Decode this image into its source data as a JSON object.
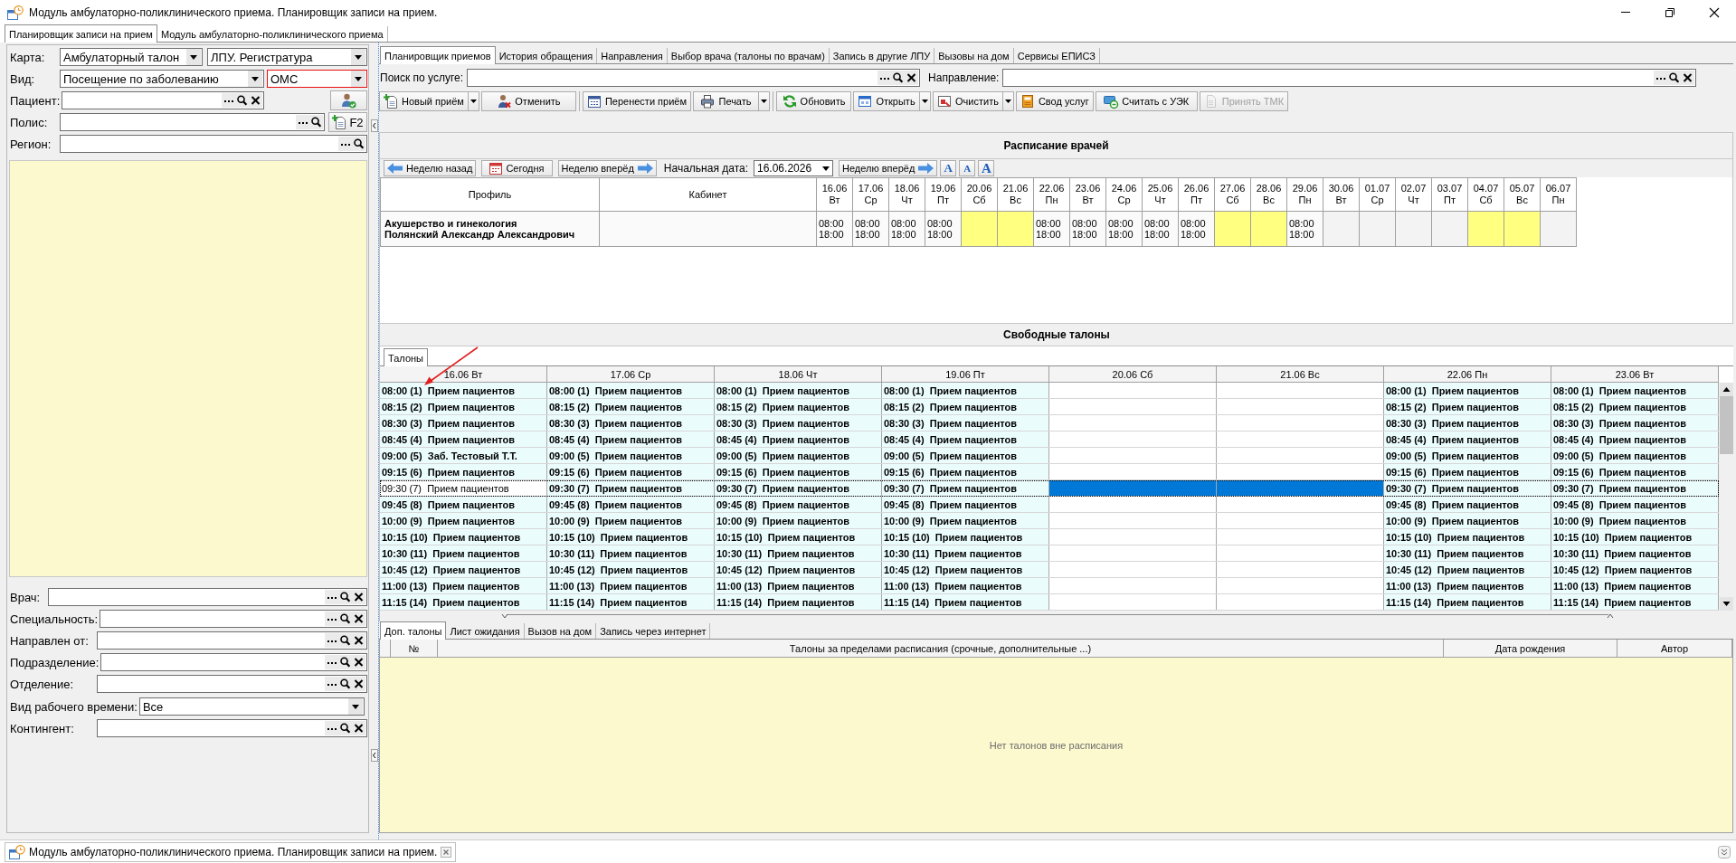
{
  "window": {
    "title": "Модуль амбулаторно-поликлинического приема. Планировщик записи на прием."
  },
  "module_tabs": [
    {
      "label": "Планировщик записи на прием",
      "selected": true
    },
    {
      "label": "Модуль амбулаторно-поликлинического приема",
      "selected": false
    }
  ],
  "patient_filters": [
    {
      "label": "Карта:",
      "controls": [
        {
          "kind": "combo",
          "value": "Амбулаторный талон",
          "invalid": false
        },
        {
          "kind": "combo",
          "value": "ЛПУ. Регистратура",
          "invalid": false
        }
      ]
    },
    {
      "label": "Вид:",
      "controls": [
        {
          "kind": "combo",
          "value": "Посещение по заболеванию",
          "invalid": false
        },
        {
          "kind": "combo",
          "value": "ОМС",
          "invalid": true
        }
      ]
    },
    {
      "label": "Пациент:",
      "controls": [
        {
          "kind": "lookup",
          "clearable": true
        },
        {
          "kind": "user-button"
        }
      ]
    },
    {
      "label": "Полис:",
      "controls": [
        {
          "kind": "lookup",
          "clearable": false
        },
        {
          "kind": "add-button",
          "label": "F2"
        }
      ]
    },
    {
      "label": "Регион:",
      "controls": [
        {
          "kind": "lookup",
          "clearable": false
        }
      ]
    }
  ],
  "doctor_filters": [
    {
      "label": "Врач:",
      "controls": [
        {
          "kind": "lookup",
          "clearable": true
        }
      ]
    },
    {
      "label": "Специальность:",
      "controls": [
        {
          "kind": "lookup",
          "clearable": true
        }
      ]
    },
    {
      "label": "Направлен от:",
      "controls": [
        {
          "kind": "lookup",
          "clearable": true
        }
      ]
    },
    {
      "label": "Подразделение:",
      "controls": [
        {
          "kind": "lookup",
          "clearable": true
        }
      ]
    },
    {
      "label": "Отделение:",
      "controls": [
        {
          "kind": "lookup",
          "clearable": true
        }
      ]
    },
    {
      "label": "Вид рабочего времени:",
      "controls": [
        {
          "kind": "combo",
          "value": "Все",
          "invalid": false
        }
      ]
    },
    {
      "label": "Контингент:",
      "controls": [
        {
          "kind": "lookup",
          "clearable": true
        }
      ]
    }
  ],
  "tabs": [
    {
      "label": "Планировщик приемов",
      "selected": true
    },
    {
      "label": "История обращения",
      "selected": false
    },
    {
      "label": "Направления",
      "selected": false
    },
    {
      "label": "Выбор врача (талоны по врачам)",
      "selected": false
    },
    {
      "label": "Запись в другие ЛПУ",
      "selected": false
    },
    {
      "label": "Вызовы на дом",
      "selected": false
    },
    {
      "label": "Сервисы ЕПИСЗ",
      "selected": false
    }
  ],
  "search": [
    {
      "label": "Поиск по услуге:",
      "clearable": true
    },
    {
      "label": "Направление:",
      "clearable": true
    }
  ],
  "toolbar": [
    [
      {
        "label": "Новый приём",
        "menu": true,
        "disabled": false
      },
      {
        "label": "Отменить",
        "menu": false,
        "disabled": false
      }
    ],
    [
      {
        "label": "Перенести приём",
        "menu": false,
        "disabled": false
      },
      {
        "label": "Печать",
        "menu": true,
        "disabled": false
      }
    ],
    [
      {
        "label": "Обновить",
        "menu": false,
        "disabled": false
      },
      {
        "label": "Открыть",
        "menu": true,
        "disabled": false
      },
      {
        "label": "Очистить",
        "menu": true,
        "disabled": false
      },
      {
        "label": "Свод услуг",
        "menu": false,
        "disabled": false
      },
      {
        "label": "Считать с УЭК",
        "menu": false,
        "disabled": false
      },
      {
        "label": "Принять ТМК",
        "menu": false,
        "disabled": true
      }
    ]
  ],
  "schedule": {
    "title": "Расписание врачей",
    "nav": [
      {
        "kind": "back",
        "label": "Неделю назад"
      },
      {
        "kind": "today",
        "label": "Сегодня"
      },
      {
        "kind": "forward",
        "label": "Неделю вперёд"
      },
      {
        "kind": "date",
        "label": "Начальная дата:",
        "value": "16.06.2026"
      },
      {
        "kind": "forward",
        "label": "Неделю вперёд"
      },
      {
        "kind": "font",
        "label": "A"
      },
      {
        "kind": "font",
        "label": "A"
      },
      {
        "kind": "font",
        "label": "A"
      }
    ],
    "columns": [
      "Профиль",
      "Кабинет"
    ],
    "dates": [
      {
        "date": "16.06",
        "weekday": "Вт"
      },
      {
        "date": "17.06",
        "weekday": "Ср"
      },
      {
        "date": "18.06",
        "weekday": "Чт"
      },
      {
        "date": "19.06",
        "weekday": "Пт"
      },
      {
        "date": "20.06",
        "weekday": "Сб"
      },
      {
        "date": "21.06",
        "weekday": "Вс"
      },
      {
        "date": "22.06",
        "weekday": "Пн"
      },
      {
        "date": "23.06",
        "weekday": "Вт"
      },
      {
        "date": "24.06",
        "weekday": "Ср"
      },
      {
        "date": "25.06",
        "weekday": "Чт"
      },
      {
        "date": "26.06",
        "weekday": "Пт"
      },
      {
        "date": "27.06",
        "weekday": "Сб"
      },
      {
        "date": "28.06",
        "weekday": "Вс"
      },
      {
        "date": "29.06",
        "weekday": "Пн"
      },
      {
        "date": "30.06",
        "weekday": "Вт"
      },
      {
        "date": "01.07",
        "weekday": "Ср"
      },
      {
        "date": "02.07",
        "weekday": "Чт"
      },
      {
        "date": "03.07",
        "weekday": "Пт"
      },
      {
        "date": "04.07",
        "weekday": "Сб"
      },
      {
        "date": "05.07",
        "weekday": "Вс"
      },
      {
        "date": "06.07",
        "weekday": "Пн"
      }
    ],
    "rows": [
      {
        "profile": "Акушерство и гинекология",
        "doctor": "Полянский Александр Александрович",
        "cells": [
          {
            "kind": "work",
            "start": "08:00",
            "end": "18:00"
          },
          {
            "kind": "work",
            "start": "08:00",
            "end": "18:00"
          },
          {
            "kind": "work",
            "start": "08:00",
            "end": "18:00"
          },
          {
            "kind": "work",
            "start": "08:00",
            "end": "18:00"
          },
          {
            "kind": "weekend"
          },
          {
            "kind": "weekend"
          },
          {
            "kind": "work",
            "start": "08:00",
            "end": "18:00"
          },
          {
            "kind": "work",
            "start": "08:00",
            "end": "18:00"
          },
          {
            "kind": "work",
            "start": "08:00",
            "end": "18:00"
          },
          {
            "kind": "work",
            "start": "08:00",
            "end": "18:00"
          },
          {
            "kind": "work",
            "start": "08:00",
            "end": "18:00"
          },
          {
            "kind": "weekend"
          },
          {
            "kind": "weekend"
          },
          {
            "kind": "work",
            "start": "08:00",
            "end": "18:00"
          },
          {
            "kind": "off"
          },
          {
            "kind": "off"
          },
          {
            "kind": "off"
          },
          {
            "kind": "off"
          },
          {
            "kind": "weekend"
          },
          {
            "kind": "weekend"
          },
          {
            "kind": "off"
          }
        ]
      }
    ]
  },
  "free_slots": {
    "title": "Свободные талоны",
    "tabs": [
      {
        "label": "Талоны",
        "selected": true
      }
    ],
    "columns": [
      "16.06 Вт",
      "17.06 Ср",
      "18.06 Чт",
      "19.06 Пт",
      "20.06 Сб",
      "21.06 Вс",
      "22.06 Пн",
      "23.06 Вт"
    ],
    "rows": [
      {
        "selected": false,
        "cells": [
          {
            "kind": "slot",
            "text": "08:00 (1)  Прием пациентов"
          },
          {
            "kind": "slot",
            "text": "08:00 (1)  Прием пациентов"
          },
          {
            "kind": "slot",
            "text": "08:00 (1)  Прием пациентов"
          },
          {
            "kind": "slot",
            "text": "08:00 (1)  Прием пациентов"
          },
          {
            "kind": "empty"
          },
          {
            "kind": "empty"
          },
          {
            "kind": "slot",
            "text": "08:00 (1)  Прием пациентов"
          },
          {
            "kind": "slot",
            "text": "08:00 (1)  Прием пациентов"
          }
        ]
      },
      {
        "selected": false,
        "cells": [
          {
            "kind": "slot",
            "text": "08:15 (2)  Прием пациентов"
          },
          {
            "kind": "slot",
            "text": "08:15 (2)  Прием пациентов"
          },
          {
            "kind": "slot",
            "text": "08:15 (2)  Прием пациентов"
          },
          {
            "kind": "slot",
            "text": "08:15 (2)  Прием пациентов"
          },
          {
            "kind": "empty"
          },
          {
            "kind": "empty"
          },
          {
            "kind": "slot",
            "text": "08:15 (2)  Прием пациентов"
          },
          {
            "kind": "slot",
            "text": "08:15 (2)  Прием пациентов"
          }
        ]
      },
      {
        "selected": false,
        "cells": [
          {
            "kind": "slot",
            "text": "08:30 (3)  Прием пациентов"
          },
          {
            "kind": "slot",
            "text": "08:30 (3)  Прием пациентов"
          },
          {
            "kind": "slot",
            "text": "08:30 (3)  Прием пациентов"
          },
          {
            "kind": "slot",
            "text": "08:30 (3)  Прием пациентов"
          },
          {
            "kind": "empty"
          },
          {
            "kind": "empty"
          },
          {
            "kind": "slot",
            "text": "08:30 (3)  Прием пациентов"
          },
          {
            "kind": "slot",
            "text": "08:30 (3)  Прием пациентов"
          }
        ]
      },
      {
        "selected": false,
        "cells": [
          {
            "kind": "slot",
            "text": "08:45 (4)  Прием пациентов"
          },
          {
            "kind": "slot",
            "text": "08:45 (4)  Прием пациентов"
          },
          {
            "kind": "slot",
            "text": "08:45 (4)  Прием пациентов"
          },
          {
            "kind": "slot",
            "text": "08:45 (4)  Прием пациентов"
          },
          {
            "kind": "empty"
          },
          {
            "kind": "empty"
          },
          {
            "kind": "slot",
            "text": "08:45 (4)  Прием пациентов"
          },
          {
            "kind": "slot",
            "text": "08:45 (4)  Прием пациентов"
          }
        ]
      },
      {
        "selected": false,
        "cells": [
          {
            "kind": "slot",
            "text": "09:00 (5)  Заб. Тестовый Т.Т."
          },
          {
            "kind": "slot",
            "text": "09:00 (5)  Прием пациентов"
          },
          {
            "kind": "slot",
            "text": "09:00 (5)  Прием пациентов"
          },
          {
            "kind": "slot",
            "text": "09:00 (5)  Прием пациентов"
          },
          {
            "kind": "empty"
          },
          {
            "kind": "empty"
          },
          {
            "kind": "slot",
            "text": "09:00 (5)  Прием пациентов"
          },
          {
            "kind": "slot",
            "text": "09:00 (5)  Прием пациентов"
          }
        ]
      },
      {
        "selected": false,
        "cells": [
          {
            "kind": "slot",
            "text": "09:15 (6)  Прием пациентов"
          },
          {
            "kind": "slot",
            "text": "09:15 (6)  Прием пациентов"
          },
          {
            "kind": "slot",
            "text": "09:15 (6)  Прием пациентов"
          },
          {
            "kind": "slot",
            "text": "09:15 (6)  Прием пациентов"
          },
          {
            "kind": "empty"
          },
          {
            "kind": "empty"
          },
          {
            "kind": "slot",
            "text": "09:15 (6)  Прием пациентов"
          },
          {
            "kind": "slot",
            "text": "09:15 (6)  Прием пациентов"
          }
        ]
      },
      {
        "selected": true,
        "cells": [
          {
            "kind": "current",
            "text": "09:30 (7)  Прием пациентов"
          },
          {
            "kind": "slot",
            "text": "09:30 (7)  Прием пациентов"
          },
          {
            "kind": "slot",
            "text": "09:30 (7)  Прием пациентов"
          },
          {
            "kind": "slot",
            "text": "09:30 (7)  Прием пациентов"
          },
          {
            "kind": "empty"
          },
          {
            "kind": "empty"
          },
          {
            "kind": "slot",
            "text": "09:30 (7)  Прием пациентов"
          },
          {
            "kind": "slot",
            "text": "09:30 (7)  Прием пациентов"
          }
        ]
      },
      {
        "selected": false,
        "cells": [
          {
            "kind": "slot",
            "text": "09:45 (8)  Прием пациентов"
          },
          {
            "kind": "slot",
            "text": "09:45 (8)  Прием пациентов"
          },
          {
            "kind": "slot",
            "text": "09:45 (8)  Прием пациентов"
          },
          {
            "kind": "slot",
            "text": "09:45 (8)  Прием пациентов"
          },
          {
            "kind": "empty"
          },
          {
            "kind": "empty"
          },
          {
            "kind": "slot",
            "text": "09:45 (8)  Прием пациентов"
          },
          {
            "kind": "slot",
            "text": "09:45 (8)  Прием пациентов"
          }
        ]
      },
      {
        "selected": false,
        "cells": [
          {
            "kind": "slot",
            "text": "10:00 (9)  Прием пациентов"
          },
          {
            "kind": "slot",
            "text": "10:00 (9)  Прием пациентов"
          },
          {
            "kind": "slot",
            "text": "10:00 (9)  Прием пациентов"
          },
          {
            "kind": "slot",
            "text": "10:00 (9)  Прием пациентов"
          },
          {
            "kind": "empty"
          },
          {
            "kind": "empty"
          },
          {
            "kind": "slot",
            "text": "10:00 (9)  Прием пациентов"
          },
          {
            "kind": "slot",
            "text": "10:00 (9)  Прием пациентов"
          }
        ]
      },
      {
        "selected": false,
        "cells": [
          {
            "kind": "slot",
            "text": "10:15 (10)  Прием пациентов"
          },
          {
            "kind": "slot",
            "text": "10:15 (10)  Прием пациентов"
          },
          {
            "kind": "slot",
            "text": "10:15 (10)  Прием пациентов"
          },
          {
            "kind": "slot",
            "text": "10:15 (10)  Прием пациентов"
          },
          {
            "kind": "empty"
          },
          {
            "kind": "empty"
          },
          {
            "kind": "slot",
            "text": "10:15 (10)  Прием пациентов"
          },
          {
            "kind": "slot",
            "text": "10:15 (10)  Прием пациентов"
          }
        ]
      },
      {
        "selected": false,
        "cells": [
          {
            "kind": "slot",
            "text": "10:30 (11)  Прием пациентов"
          },
          {
            "kind": "slot",
            "text": "10:30 (11)  Прием пациентов"
          },
          {
            "kind": "slot",
            "text": "10:30 (11)  Прием пациентов"
          },
          {
            "kind": "slot",
            "text": "10:30 (11)  Прием пациентов"
          },
          {
            "kind": "empty"
          },
          {
            "kind": "empty"
          },
          {
            "kind": "slot",
            "text": "10:30 (11)  Прием пациентов"
          },
          {
            "kind": "slot",
            "text": "10:30 (11)  Прием пациентов"
          }
        ]
      },
      {
        "selected": false,
        "cells": [
          {
            "kind": "slot",
            "text": "10:45 (12)  Прием пациентов"
          },
          {
            "kind": "slot",
            "text": "10:45 (12)  Прием пациентов"
          },
          {
            "kind": "slot",
            "text": "10:45 (12)  Прием пациентов"
          },
          {
            "kind": "slot",
            "text": "10:45 (12)  Прием пациентов"
          },
          {
            "kind": "empty"
          },
          {
            "kind": "empty"
          },
          {
            "kind": "slot",
            "text": "10:45 (12)  Прием пациентов"
          },
          {
            "kind": "slot",
            "text": "10:45 (12)  Прием пациентов"
          }
        ]
      },
      {
        "selected": false,
        "cells": [
          {
            "kind": "slot",
            "text": "11:00 (13)  Прием пациентов"
          },
          {
            "kind": "slot",
            "text": "11:00 (13)  Прием пациентов"
          },
          {
            "kind": "slot",
            "text": "11:00 (13)  Прием пациентов"
          },
          {
            "kind": "slot",
            "text": "11:00 (13)  Прием пациентов"
          },
          {
            "kind": "empty"
          },
          {
            "kind": "empty"
          },
          {
            "kind": "slot",
            "text": "11:00 (13)  Прием пациентов"
          },
          {
            "kind": "slot",
            "text": "11:00 (13)  Прием пациентов"
          }
        ]
      },
      {
        "selected": false,
        "cells": [
          {
            "kind": "slot",
            "text": "11:15 (14)  Прием пациентов"
          },
          {
            "kind": "slot",
            "text": "11:15 (14)  Прием пациентов"
          },
          {
            "kind": "slot",
            "text": "11:15 (14)  Прием пациентов"
          },
          {
            "kind": "slot",
            "text": "11:15 (14)  Прием пациентов"
          },
          {
            "kind": "empty"
          },
          {
            "kind": "empty"
          },
          {
            "kind": "slot",
            "text": "11:15 (14)  Прием пациентов"
          },
          {
            "kind": "slot",
            "text": "11:15 (14)  Прием пациентов"
          }
        ]
      }
    ]
  },
  "extra_slots": {
    "tabs": [
      {
        "label": "Доп. талоны",
        "selected": true
      },
      {
        "label": "Лист ожидания",
        "selected": false
      },
      {
        "label": "Вызов на дом",
        "selected": false
      },
      {
        "label": "Запись через интернет",
        "selected": false
      }
    ],
    "columns": [
      "№",
      "Талоны за пределами расписания (срочные, дополнительные ...)",
      "Дата рождения",
      "Автор"
    ],
    "empty_message": "Нет талонов вне расписания"
  },
  "taskbar": {
    "items": [
      {
        "label": "Модуль амбулаторно-поликлинического приема. Планировщик записи на прием.",
        "selected": true
      }
    ]
  }
}
